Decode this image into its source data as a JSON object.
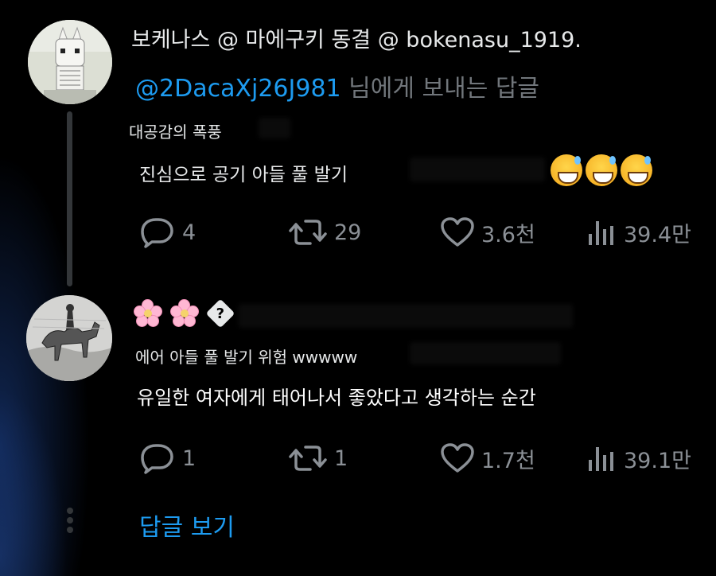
{
  "tweets": [
    {
      "username": "보케나스 @ 마에구키 동결 @ bokenasu_1919.",
      "reply_mention": "@2DacaXj26J981",
      "reply_suffix": " 님에게 보내는 답글",
      "subname": "대공감의 폭풍",
      "body": "진심으로 공기 아들 풀 발기",
      "emojis": [
        "grinning-sweat-emoji",
        "grinning-sweat-emoji",
        "grinning-sweat-emoji"
      ],
      "stats": {
        "replies": "4",
        "retweets": "29",
        "likes": "3.6천",
        "views": "39.4만"
      }
    },
    {
      "username_icons": [
        "cherry-blossom-icon",
        "cherry-blossom-icon",
        "unknown-glyph-icon"
      ],
      "unknown_glyph": "?",
      "subname": "에어 아들 풀 발기 위험 wwwww",
      "body": "유일한 여자에게 태어나서 좋았다고 생각하는 순간",
      "stats": {
        "replies": "1",
        "retweets": "1",
        "likes": "1.7천",
        "views": "39.1만"
      }
    }
  ],
  "show_replies": "답글 보기",
  "colors": {
    "accent": "#1d9bf0",
    "muted": "#8b9096",
    "text": "#e7e9ea",
    "background": "#000000"
  }
}
